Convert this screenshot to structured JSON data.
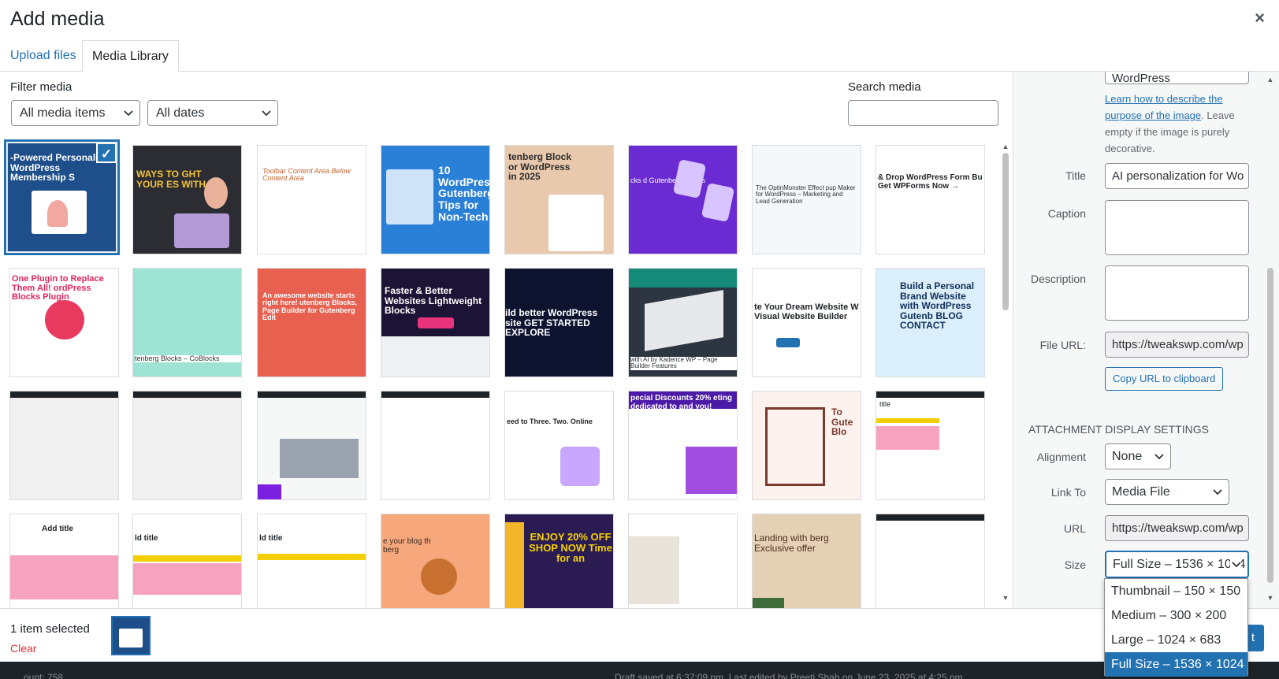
{
  "header": {
    "title": "Add media",
    "close_glyph": "×"
  },
  "tabs": [
    {
      "label": "Upload files"
    },
    {
      "label": "Media Library"
    }
  ],
  "filters": {
    "label": "Filter media",
    "type_value": "All media items",
    "date_value": "All dates",
    "search_label": "Search media"
  },
  "thumbnails": [
    {
      "label": "-Powered Personaliz WordPress Membership S"
    },
    {
      "label": "WAYS TO GHT YOUR ES WITH"
    },
    {
      "label": "Toolbar  Content Area  Below Content Area"
    },
    {
      "label": "10 WordPress Gutenberg Tips for Non-Tech"
    },
    {
      "label": "tenberg Block or WordPress in 2025"
    },
    {
      "label": "cks  d Gutenberg Blocks"
    },
    {
      "label": "The OptinMonster Effect  pup Maker for WordPress – Marketing and Lead Generation"
    },
    {
      "label": "& Drop WordPress Form Bu  Get WPForms Now →"
    },
    {
      "label": "One Plugin to Replace Them All!  ordPress Blocks Plugin"
    },
    {
      "label": "tenberg Blocks – CoBlocks"
    },
    {
      "label": "An awesome website starts right here!  utenberg Blocks, Page Builder for Gutenberg Edit"
    },
    {
      "label": "Faster & Better Websites Lightweight Blocks"
    },
    {
      "label": "ild better WordPress site  GET STARTED  EXPLORE"
    },
    {
      "label": "with AI by Kadence WP – Page Builder Features"
    },
    {
      "label": "te Your Dream Website W Visual Website Builder"
    },
    {
      "label": "Build a Personal Brand Website with WordPress Gutenb  BLOG  CONTACT"
    },
    {
      "label": ""
    },
    {
      "label": ""
    },
    {
      "label": ""
    },
    {
      "label": ""
    },
    {
      "label": "eed to  Three. Two. Online"
    },
    {
      "label": "pecial Discounts  20%  eting dedicated to and you!"
    },
    {
      "label": "To Gute Blo"
    },
    {
      "label": "title"
    },
    {
      "label": "Add title"
    },
    {
      "label": "ld title"
    },
    {
      "label": "ld title"
    },
    {
      "label": "e your blog th berg"
    },
    {
      "label": "ENJOY 20% OFF  SHOP NOW  Time for an"
    },
    {
      "label": ""
    },
    {
      "label": "Landing with berg  Exclusive offer"
    },
    {
      "label": ""
    }
  ],
  "sidebar": {
    "alt_partial": "WordPress",
    "help_link": "Learn how to describe the purpose of the image",
    "help_rest": ". Leave empty if the image is purely decorative.",
    "title_label": "Title",
    "title_value": "AI personalization for Wo",
    "caption_label": "Caption",
    "description_label": "Description",
    "file_url_label": "File URL:",
    "file_url_value": "https://tweakswp.com/wp",
    "copy_button": "Copy URL to clipboard",
    "display_settings_title": "Attachment Display Settings",
    "alignment_label": "Alignment",
    "alignment_value": "None",
    "link_to_label": "Link To",
    "link_to_value": "Media File",
    "url_label": "URL",
    "url_value": "https://tweakswp.com/wp",
    "size_label": "Size",
    "size_value": "Full Size – 1536 × 1024",
    "size_options": [
      "Thumbnail – 150 × 150",
      "Medium – 300 × 200",
      "Large – 1024 × 683",
      "Full Size – 1536 × 1024"
    ]
  },
  "toolbar": {
    "selected_count": "1 item selected",
    "clear": "Clear",
    "insert_button": "t"
  },
  "statusbar": {
    "left": "ount: 758",
    "right": "Draft saved at 6:37:09 pm. Last edited by Preeti Shah on June 23, 2025 at 4:25 pm"
  },
  "colors": {
    "accent": "#2271b1",
    "danger": "#d63638",
    "sidebar_bg": "#f6f7f7"
  }
}
